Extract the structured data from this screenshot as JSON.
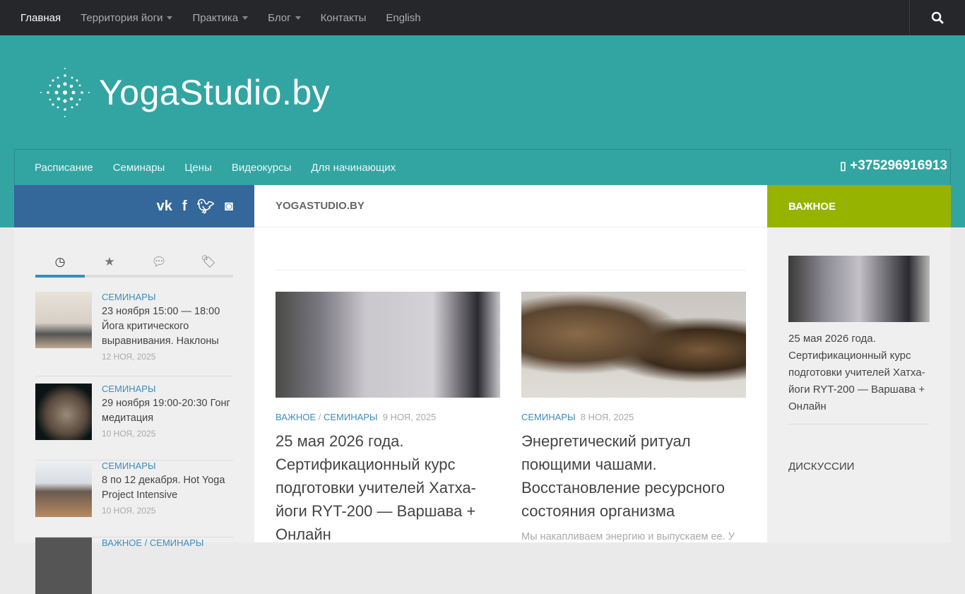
{
  "topnav": {
    "items": [
      {
        "label": "Главная",
        "caret": false
      },
      {
        "label": "Территория йоги",
        "caret": true
      },
      {
        "label": "Практика",
        "caret": true
      },
      {
        "label": "Блог",
        "caret": true
      },
      {
        "label": "Контакты",
        "caret": false
      },
      {
        "label": "English",
        "caret": false
      }
    ]
  },
  "logo": {
    "text": "YogaStudio.by"
  },
  "subnav": {
    "items": [
      "Расписание",
      "Семинары",
      "Цены",
      "Видеокурсы",
      "Для начинающих"
    ],
    "phone": "+375296916913"
  },
  "colors": {
    "top": "#26272b",
    "teal": "#32a5a2",
    "blue": "#34679a",
    "green": "#96b300",
    "link": "#3b8dbd"
  },
  "sidebar": {
    "items": [
      {
        "cat": "Семинары",
        "title": "23 ноября 15:00 — 18:00 Йога критического выравнивания. Наклоны",
        "date": "12 НОЯ, 2025"
      },
      {
        "cat": "Семинары",
        "title": "29 ноября 19:00-20:30 Гонг медитация",
        "date": "10 НОЯ, 2025"
      },
      {
        "cat": "Семинары",
        "title": "8 по 12 декабря. Hot Yoga Project Intensive",
        "date": "10 НОЯ, 2025"
      },
      {
        "cat": "Важное / Семинары"
      }
    ]
  },
  "main": {
    "heading": "YOGASTUDIO.BY",
    "posts": [
      {
        "cat1": "Важное",
        "sep": "/",
        "cat2": "Семинары",
        "date": "9 НОЯ, 2025",
        "title": "25 мая 2026 года. Сертификационный курс подготовки учителей Хатха-йоги RYT-200 — Варшава + Онлайн"
      },
      {
        "cat1": "Семинары",
        "date": "8 НОЯ, 2025",
        "title": "Энергетический ритуал поющими чашами. Восстановление ресурсного состояния организма",
        "excerpt": "Мы накапливаем энергию и выпускаем ее. У"
      }
    ]
  },
  "right": {
    "heading": "Важное",
    "title": "25 мая 2026 года. Сертификационный курс подготовки учителей Хатха-йоги RYT-200 — Варшава + Онлайн",
    "discussions": "ДИСКУССИИ"
  }
}
